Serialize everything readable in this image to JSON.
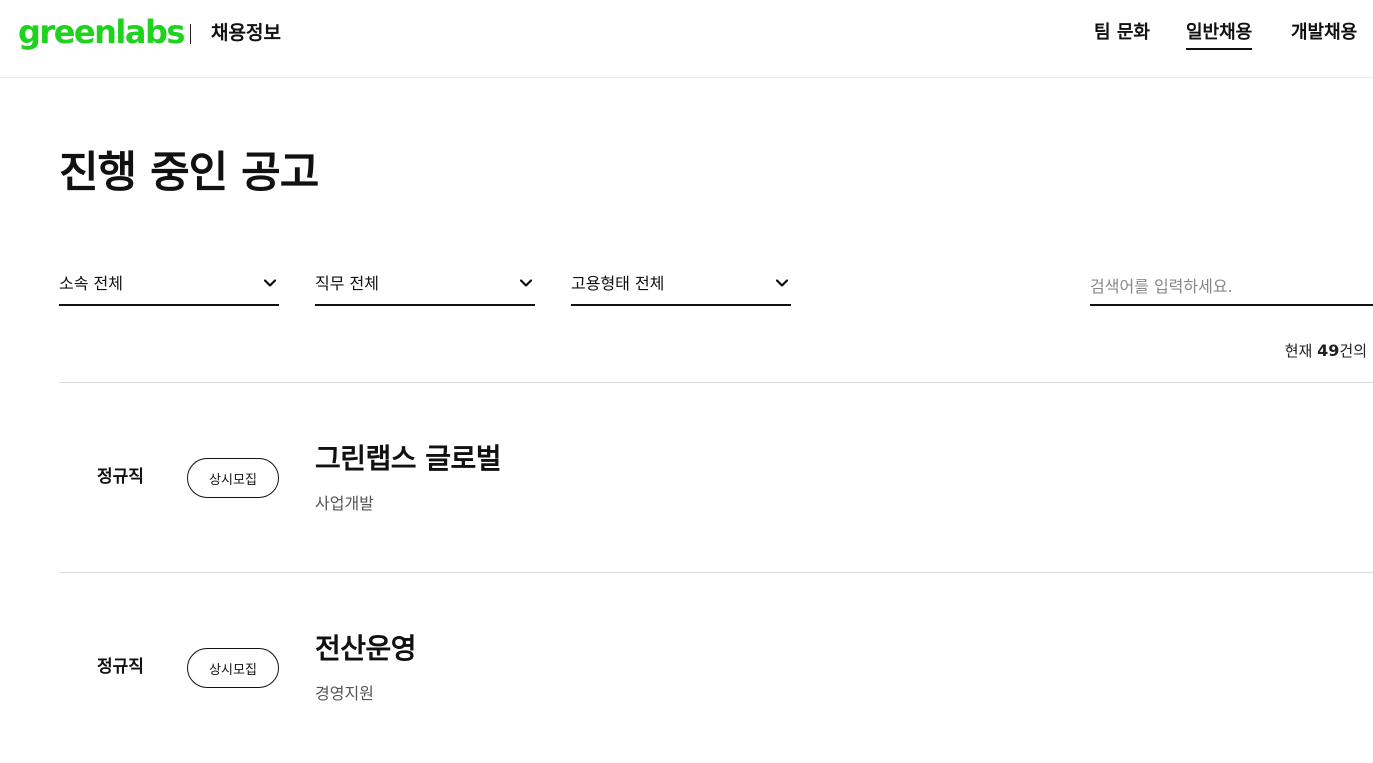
{
  "header": {
    "logo": "greenlabs",
    "section_title": "채용정보",
    "nav": [
      {
        "label": "팀 문화"
      },
      {
        "label": "일반채용",
        "active": true
      },
      {
        "label": "개발채용"
      }
    ]
  },
  "main": {
    "title": "진행 중인 공고",
    "filters": [
      {
        "label": "소속 전체"
      },
      {
        "label": "직무 전체"
      },
      {
        "label": "고용형태 전체"
      }
    ],
    "search": {
      "placeholder": "검색어를 입력하세요.",
      "value": ""
    },
    "count": {
      "prefix": "현재 ",
      "number": "49",
      "suffix": "건의"
    },
    "jobs": [
      {
        "type": "정규직",
        "badge": "상시모집",
        "title": "그린랩스 글로벌",
        "department": "사업개발"
      },
      {
        "type": "정규직",
        "badge": "상시모집",
        "title": "전산운영",
        "department": "경영지원"
      }
    ]
  },
  "colors": {
    "brand": "#1ed21e",
    "text": "#111111",
    "muted": "#555555",
    "divider": "#dcdcdc"
  },
  "icons": {
    "filter": "chevron-down-icon"
  }
}
